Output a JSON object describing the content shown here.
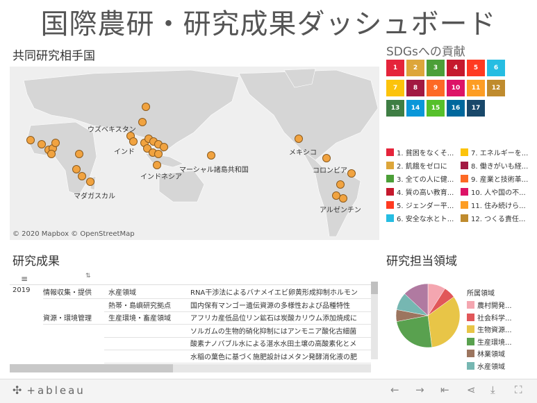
{
  "title": "国際農研・研究成果ダッシュボード",
  "sections": {
    "map_title": "共同研究相手国",
    "sdg_title": "SDGsへの貢献",
    "results_title": "研究成果",
    "domain_title": "研究担当領域"
  },
  "map": {
    "attribution": "© 2020 Mapbox © OpenStreetMap",
    "labels": [
      "ウズベキスタン",
      "インド",
      "インドネシア",
      "マダガスカル",
      "マーシャル諸島共和国",
      "メキシコ",
      "コロンビア",
      "アルゼンチン"
    ]
  },
  "sdg_tiles": [
    {
      "num": "1",
      "color": "#e5243b"
    },
    {
      "num": "2",
      "color": "#dda63a"
    },
    {
      "num": "3",
      "color": "#4c9f38"
    },
    {
      "num": "4",
      "color": "#c5192d"
    },
    {
      "num": "5",
      "color": "#ff3a21"
    },
    {
      "num": "6",
      "color": "#26bde2"
    },
    {
      "num": "7",
      "color": "#fcc30b"
    },
    {
      "num": "8",
      "color": "#a21942"
    },
    {
      "num": "9",
      "color": "#fd6925"
    },
    {
      "num": "10",
      "color": "#dd1367"
    },
    {
      "num": "11",
      "color": "#fd9d24"
    },
    {
      "num": "12",
      "color": "#bf8b2e"
    },
    {
      "num": "13",
      "color": "#3f7e44"
    },
    {
      "num": "14",
      "color": "#0a97d9"
    },
    {
      "num": "15",
      "color": "#56c02b"
    },
    {
      "num": "16",
      "color": "#00689d"
    },
    {
      "num": "17",
      "color": "#19486a"
    }
  ],
  "sdg_legend": [
    {
      "label": "1. 貧困をなくそ...",
      "color": "#e5243b"
    },
    {
      "label": "7. エネルギーを...",
      "color": "#fcc30b"
    },
    {
      "label": "2. 飢餓をゼロに",
      "color": "#dda63a"
    },
    {
      "label": "8. 働きがいも経...",
      "color": "#a21942"
    },
    {
      "label": "3. 全ての人に健...",
      "color": "#4c9f38"
    },
    {
      "label": "9. 産業と技術革...",
      "color": "#fd6925"
    },
    {
      "label": "4. 質の高い教育...",
      "color": "#c5192d"
    },
    {
      "label": "10. 人や国の不...",
      "color": "#dd1367"
    },
    {
      "label": "5. ジェンダー平...",
      "color": "#ff3a21"
    },
    {
      "label": "11. 住み続けら...",
      "color": "#fd9d24"
    },
    {
      "label": "6. 安全な水とト...",
      "color": "#26bde2"
    },
    {
      "label": "12. つくる責任...",
      "color": "#bf8b2e"
    }
  ],
  "results_table": {
    "rows": [
      {
        "year": "2019",
        "category": "情報収集・提供",
        "domain": "水産領域",
        "title": "RNA干渉法によるバナメイエビ卵黄形成抑制ホルモン"
      },
      {
        "year": "",
        "category": "",
        "domain": "熱帯・島嶼研究拠点",
        "title": "国内保有マンゴー遺伝資源の多様性および品種特性"
      },
      {
        "year": "",
        "category": "資源・環境管理",
        "domain": "生産環境・畜産領域",
        "title": "アフリカ産低品位リン鉱石は炭酸カリウム添加焼成に"
      },
      {
        "year": "",
        "category": "",
        "domain": "",
        "title": "ソルガムの生物的硝化抑制にはアンモニア酸化古細菌"
      },
      {
        "year": "",
        "category": "",
        "domain": "",
        "title": "酸素ナノバブル水による湛水水田土壌の高酸素化とメ"
      },
      {
        "year": "",
        "category": "",
        "domain": "",
        "title": "水稲の葉色に基づく施肥設計はメタン発酵消化液の肥"
      }
    ]
  },
  "pie": {
    "legend_title": "所属領域",
    "slices": [
      {
        "label": "農村開発...",
        "color": "#f4a6b0",
        "value": 9
      },
      {
        "label": "社会科学...",
        "color": "#e15759",
        "value": 6
      },
      {
        "label": "生物資源...",
        "color": "#e8c547",
        "value": 33
      },
      {
        "label": "生産環境...",
        "color": "#59a14f",
        "value": 24
      },
      {
        "label": "林業領域",
        "color": "#9c755f",
        "value": 6
      },
      {
        "label": "水産領域",
        "color": "#76b7b2",
        "value": 9
      },
      {
        "label": "",
        "color": "#b07aa1",
        "value": 13
      }
    ]
  },
  "toolbar": {
    "brand": "+ableau"
  }
}
